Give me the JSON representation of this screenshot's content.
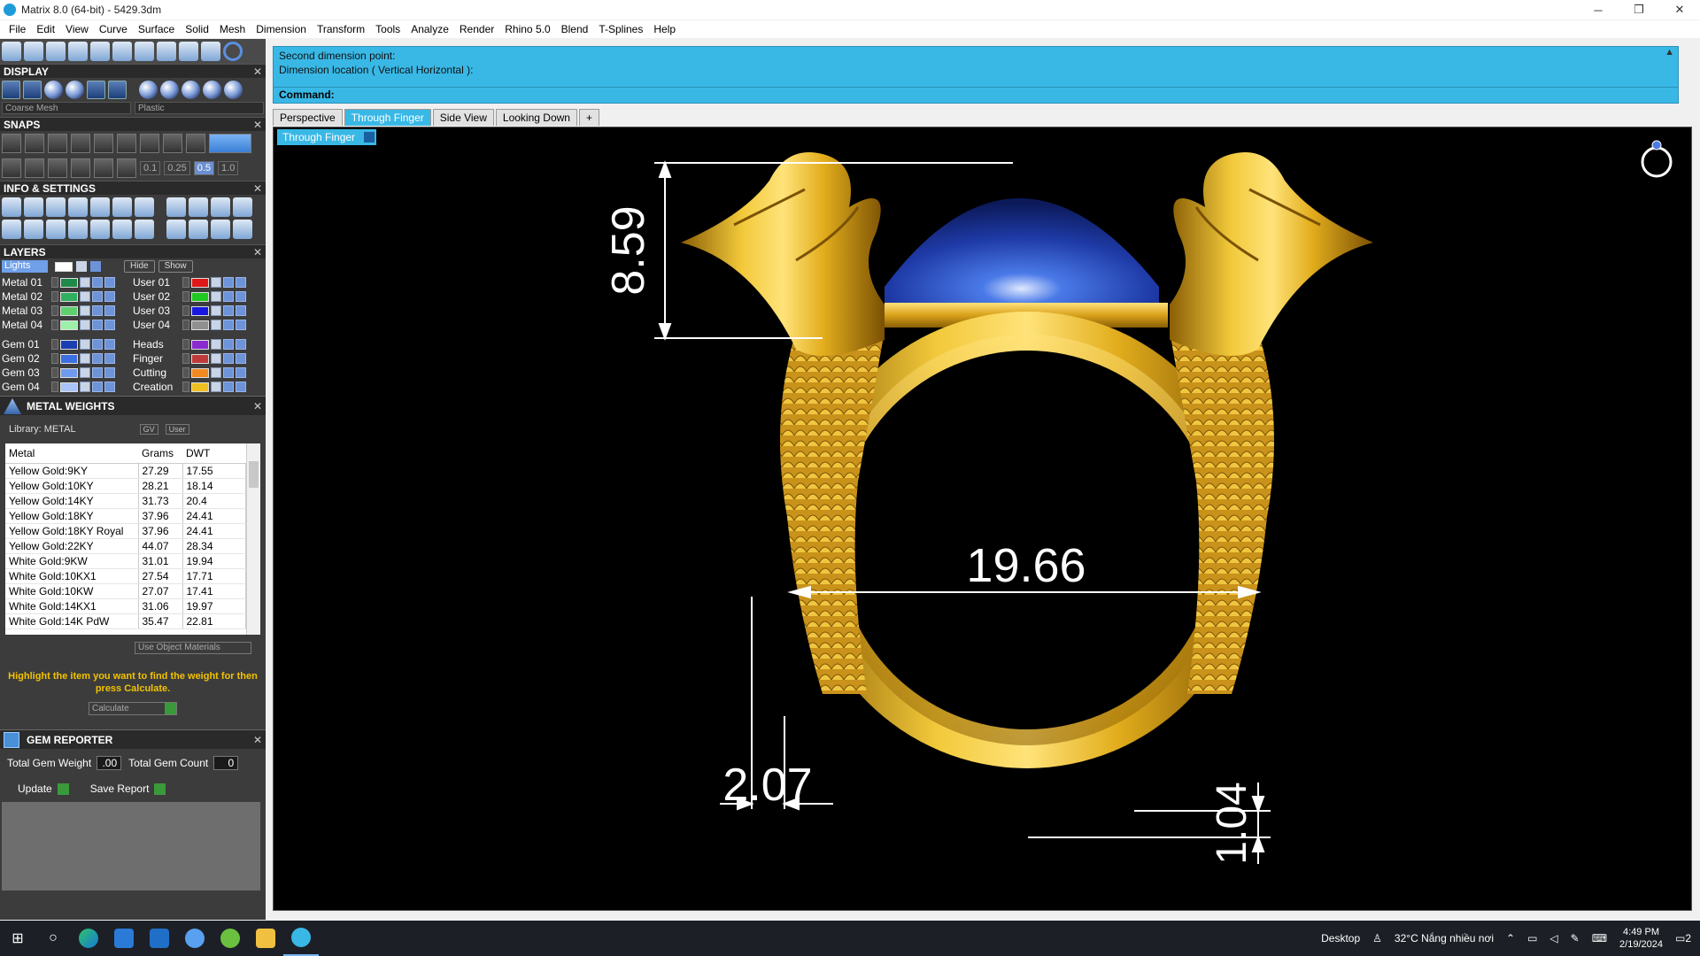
{
  "window": {
    "title": "Matrix 8.0 (64-bit) - 5429.3dm",
    "minimize": "─",
    "restore": "❐",
    "close": "✕"
  },
  "menu": [
    "File",
    "Edit",
    "View",
    "Curve",
    "Surface",
    "Solid",
    "Mesh",
    "Dimension",
    "Transform",
    "Tools",
    "Analyze",
    "Render",
    "Rhino 5.0",
    "Blend",
    "T-Splines",
    "Help"
  ],
  "panels": {
    "display": {
      "title": "DISPLAY",
      "mesh": "Coarse Mesh",
      "material": "Plastic"
    },
    "snaps": {
      "title": "SNAPS",
      "values": [
        "0.1",
        "0.25",
        "0.5",
        "1.0"
      ]
    },
    "info": {
      "title": "INFO & SETTINGS"
    },
    "layers": {
      "title": "LAYERS",
      "lights": "Lights",
      "hide": "Hide",
      "show": "Show",
      "left": [
        {
          "name": "Metal 01",
          "color": "#1f8a4a"
        },
        {
          "name": "Metal 02",
          "color": "#2fb05e"
        },
        {
          "name": "Metal 03",
          "color": "#5fd070"
        },
        {
          "name": "Metal 04",
          "color": "#9cf0a8"
        },
        {
          "name": "Gem 01",
          "color": "#1a3fb0"
        },
        {
          "name": "Gem 02",
          "color": "#3c6fe0"
        },
        {
          "name": "Gem 03",
          "color": "#6f9af0"
        },
        {
          "name": "Gem 04",
          "color": "#a8c4f8"
        }
      ],
      "right": [
        {
          "name": "User 01",
          "color": "#e01818"
        },
        {
          "name": "User 02",
          "color": "#20c820"
        },
        {
          "name": "User 03",
          "color": "#1818e0"
        },
        {
          "name": "User 04",
          "color": "#909090"
        },
        {
          "name": "Heads",
          "color": "#8a2ad0"
        },
        {
          "name": "Finger",
          "color": "#c03a3a"
        },
        {
          "name": "Cutting",
          "color": "#f08a20"
        },
        {
          "name": "Creation",
          "color": "#f0c020"
        }
      ]
    },
    "metal_weights": {
      "title": "METAL WEIGHTS",
      "library": "Library: METAL",
      "gv": "GV",
      "user": "User",
      "columns": [
        "Metal",
        "Grams",
        "DWT"
      ],
      "rows": [
        [
          "Yellow Gold:9KY",
          "27.29",
          "17.55"
        ],
        [
          "Yellow Gold:10KY",
          "28.21",
          "18.14"
        ],
        [
          "Yellow Gold:14KY",
          "31.73",
          "20.4"
        ],
        [
          "Yellow Gold:18KY",
          "37.96",
          "24.41"
        ],
        [
          "Yellow Gold:18KY Royal",
          "37.96",
          "24.41"
        ],
        [
          "Yellow Gold:22KY",
          "44.07",
          "28.34"
        ],
        [
          "White Gold:9KW",
          "31.01",
          "19.94"
        ],
        [
          "White Gold:10KX1",
          "27.54",
          "17.71"
        ],
        [
          "White Gold:10KW",
          "27.07",
          "17.41"
        ],
        [
          "White Gold:14KX1",
          "31.06",
          "19.97"
        ],
        [
          "White Gold:14K PdW",
          "35.47",
          "22.81"
        ]
      ],
      "use_object_materials": "Use Object Materials",
      "hint": "Highlight the item you want to find the weight for then press Calculate.",
      "calculate": "Calculate"
    },
    "gem_reporter": {
      "title": "GEM REPORTER",
      "total_weight_label": "Total Gem Weight",
      "total_weight": ".00",
      "total_count_label": "Total Gem Count",
      "total_count": "0",
      "update": "Update",
      "save_report": "Save Report"
    }
  },
  "command": {
    "line1": "Second dimension point:",
    "line2": "Dimension location ( Vertical  Horizontal ):",
    "prompt": "Command:"
  },
  "tabs": [
    "Perspective",
    "Through Finger",
    "Side View",
    "Looking Down",
    "+"
  ],
  "active_tab": "Through Finger",
  "viewport": {
    "label": "Through Finger",
    "dimensions": {
      "height": "8.59",
      "inner": "19.66",
      "thickness": "2.07",
      "bottom": "1.04"
    },
    "colors": {
      "gold": "#e0b21c",
      "gem": "#1f3ea8",
      "background": "#000000"
    }
  },
  "taskbar": {
    "desktop": "Desktop",
    "weather": "32°C  Nắng nhiều nơi",
    "time": "4:49 PM",
    "date": "2/19/2024",
    "notif": "2"
  }
}
